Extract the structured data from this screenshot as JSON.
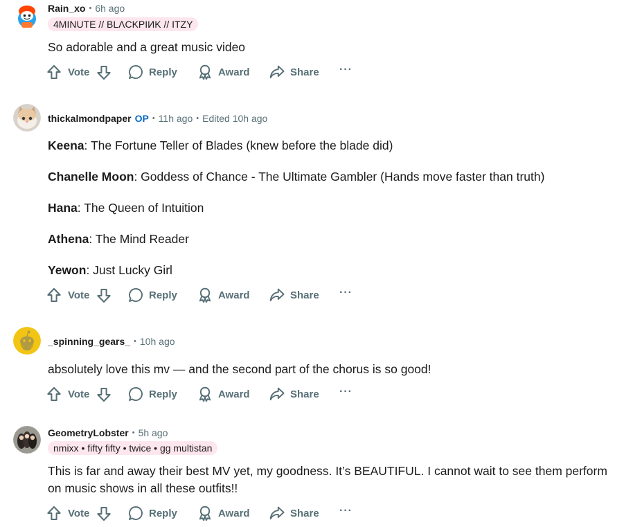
{
  "actions": {
    "vote": "Vote",
    "reply": "Reply",
    "award": "Award",
    "share": "Share",
    "more": "···"
  },
  "comments": [
    {
      "author": "Rain_xo",
      "time": "6h ago",
      "flair": "4MINUTE // BLΛCKPIИK // ITZY",
      "body": "So adorable and a great music video"
    },
    {
      "author": "thickalmondpaper",
      "op": "OP",
      "time": "11h ago",
      "edited": "Edited 10h ago",
      "lines": [
        {
          "name": "Keena",
          "text": ": The Fortune Teller of Blades (knew before the blade did)"
        },
        {
          "name": "Chanelle Moon",
          "text": ": Goddess of Chance - The Ultimate Gambler (Hands move faster than truth)"
        },
        {
          "name": "Hana",
          "text": ": The Queen of Intuition"
        },
        {
          "name": "Athena",
          "text": ": The Mind Reader"
        },
        {
          "name": "Yewon",
          "text": ": Just Lucky Girl"
        }
      ]
    },
    {
      "author": "_spinning_gears_",
      "time": "10h ago",
      "body": "absolutely love this mv — and the second part of the chorus is so good!"
    },
    {
      "author": "GeometryLobster",
      "time": "5h ago",
      "flair": "nmixx • fifty fifty • twice • gg multistan",
      "body": "This is far and away their best MV yet, my goodness. It’s BEAUTIFUL. I cannot wait to see them perform on music shows in all these outfits!!"
    }
  ],
  "colors": {
    "op": "#0a6ac4",
    "flair_bg": "#fde6ee",
    "meta": "#576f76"
  }
}
